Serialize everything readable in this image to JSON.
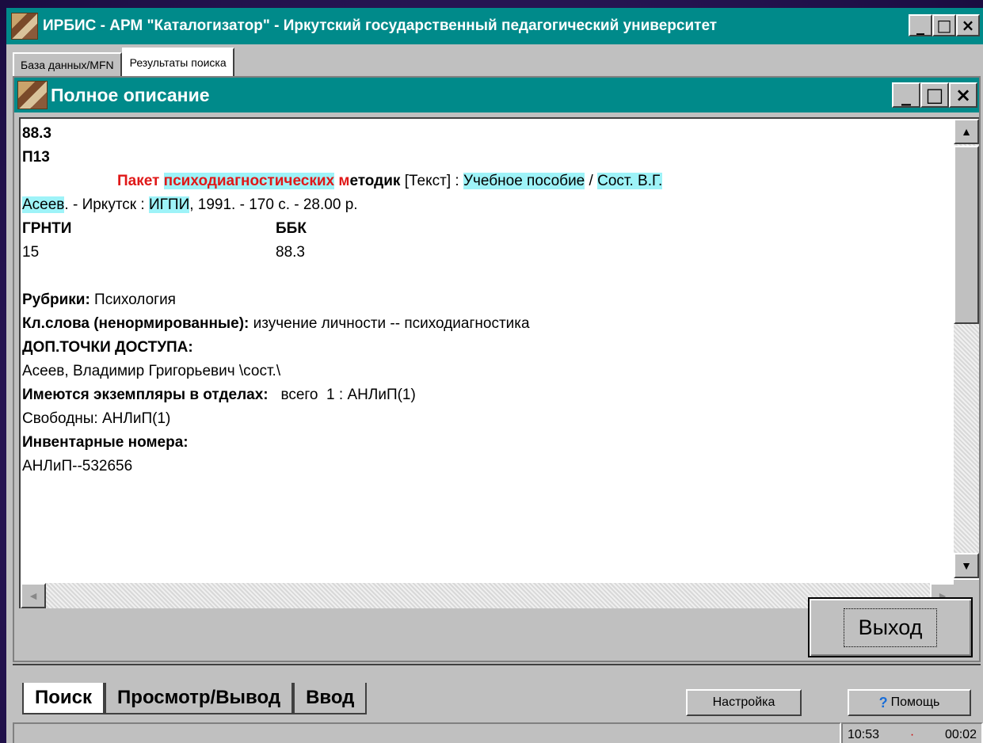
{
  "window": {
    "title": "ИРБИС - АРМ \"Каталогизатор\" - Иркутский государственный педагогический университет",
    "min": "_",
    "max": "□",
    "close": "×"
  },
  "top_tabs": [
    {
      "label": "База данных/MFN"
    },
    {
      "label": "Результаты поиска"
    }
  ],
  "dialog": {
    "title": "Полное описание",
    "min": "_",
    "max": "□",
    "close": "×"
  },
  "record": {
    "l1": "88.3",
    "l2": "П13",
    "title_a": "Пакет",
    "title_b": "психодиагностических",
    "title_c1": "м",
    "title_c2": "етодик",
    "title_d": " [Текст] : ",
    "title_e": "Учебное пособие",
    "title_f": " / ",
    "title_g": "Сост. В.Г.",
    "l4a": "Асеев",
    "l4b": ". - Иркутск : ",
    "l4c": "ИГПИ",
    "l4d": ", 1991. - 170 с. - 28.00 р.",
    "grnti_label": "ГРНТИ",
    "bbk_label": "ББК",
    "grnti_value": "15",
    "bbk_value": "88.3",
    "rub_label": "Рубрики:",
    "rub_value": " Психология",
    "kw_label": "Кл.слова (ненормированные):",
    "kw_value": " изучение личности -- психодиагностика",
    "dop_label": "ДОП.ТОЧКИ ДОСТУПА:",
    "dop_value": "Асеев, Владимир Григорьевич \\сост.\\",
    "ex_label": "Имеются экземпляры в отделах:",
    "ex_value": "   всего  1 : АНЛиП(1)",
    "free": "Свободны: АНЛиП(1)",
    "inv_label": "Инвентарные номера:",
    "inv_value": "АНЛиП--532656"
  },
  "exit_button": "Выход",
  "bottom_tabs": [
    {
      "label": "Поиск"
    },
    {
      "label": "Просмотр/Вывод"
    },
    {
      "label": "Ввод"
    }
  ],
  "settings_button": "Настройка",
  "help_button": "Помощь",
  "status": {
    "time": "10:53",
    "dot": "·",
    "elapsed": "00:02"
  }
}
